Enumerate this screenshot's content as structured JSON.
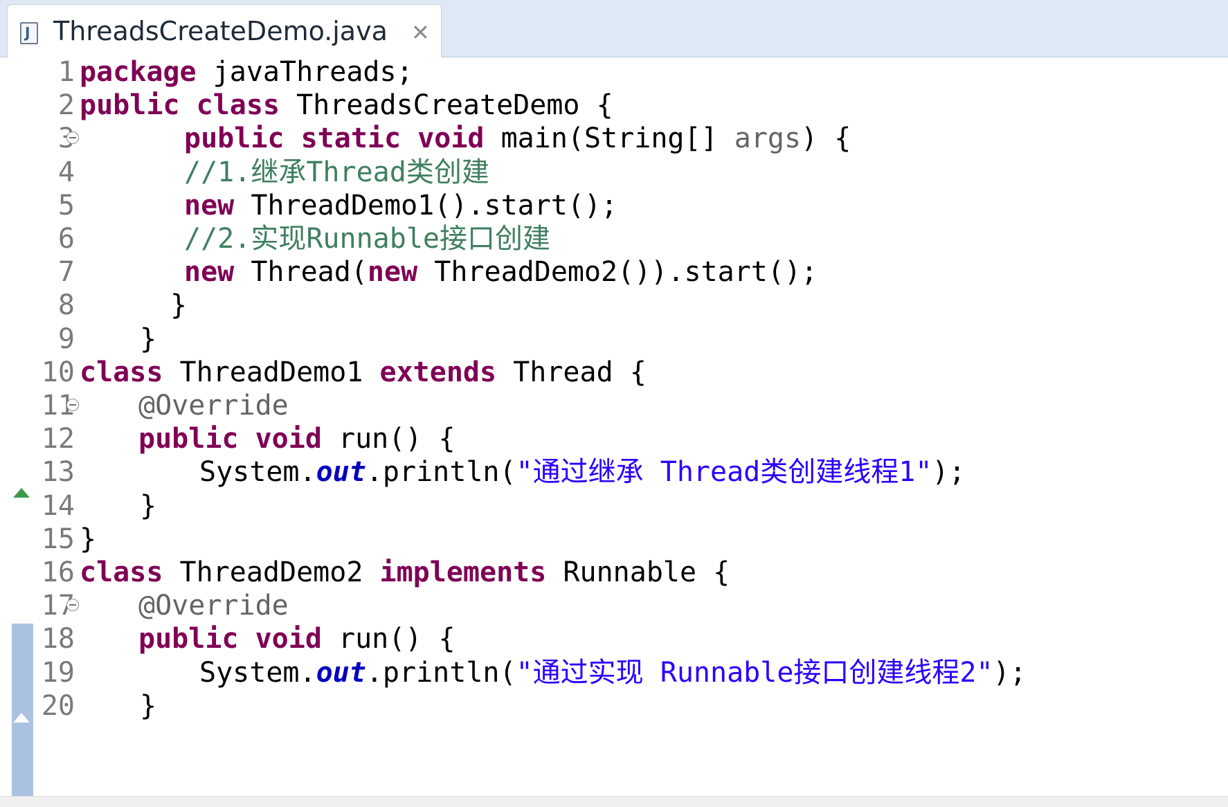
{
  "editor_tab": {
    "title": "ThreadsCreateDemo.java",
    "file_icon": "java-file-icon",
    "close_glyph": "✕"
  },
  "colors": {
    "keyword": "#7f0055",
    "comment": "#3f7f5f",
    "string": "#2a00ff",
    "annotation": "#646464",
    "static_field": "#0000c0",
    "line_number": "#7a7a7a",
    "tab_bar": "#dfe9f5",
    "range_indicator": "#aac2e0"
  },
  "code": {
    "lines": [
      {
        "n": "1",
        "foldable": false,
        "tokens": [
          {
            "t": "package",
            "k": "kw"
          },
          {
            "t": " javaThreads;",
            "k": "ty"
          }
        ]
      },
      {
        "n": "2",
        "foldable": false,
        "tokens": [
          {
            "t": "public",
            "k": "kw"
          },
          {
            "t": " ",
            "k": "ty"
          },
          {
            "t": "class",
            "k": "kw"
          },
          {
            "t": " ThreadsCreateDemo {",
            "k": "ty"
          }
        ]
      },
      {
        "n": "3",
        "foldable": true,
        "tokens": [
          {
            "t": "public",
            "k": "kw"
          },
          {
            "t": " ",
            "k": "ty"
          },
          {
            "t": "static",
            "k": "kw"
          },
          {
            "t": " ",
            "k": "ty"
          },
          {
            "t": "void",
            "k": "kw"
          },
          {
            "t": " main(String[] ",
            "k": "ty"
          },
          {
            "t": "args",
            "k": "an"
          },
          {
            "t": ") {",
            "k": "ty"
          }
        ]
      },
      {
        "n": "4",
        "foldable": false,
        "tokens": [
          {
            "t": "//1.继承Thread类创建",
            "k": "cm"
          }
        ]
      },
      {
        "n": "5",
        "foldable": false,
        "tokens": [
          {
            "t": "new",
            "k": "kw"
          },
          {
            "t": " ThreadDemo1().start();",
            "k": "ty"
          }
        ]
      },
      {
        "n": "6",
        "foldable": false,
        "tokens": [
          {
            "t": "//2.实现Runnable接口创建",
            "k": "cm"
          }
        ]
      },
      {
        "n": "7",
        "foldable": false,
        "tokens": [
          {
            "t": "new",
            "k": "kw"
          },
          {
            "t": " Thread(",
            "k": "ty"
          },
          {
            "t": "new",
            "k": "kw"
          },
          {
            "t": " ThreadDemo2()).start();",
            "k": "ty"
          }
        ]
      },
      {
        "n": "8",
        "foldable": false,
        "tokens": [
          {
            "t": "}",
            "k": "ty"
          }
        ]
      },
      {
        "n": "9",
        "foldable": false,
        "tokens": [
          {
            "t": "}",
            "k": "ty"
          }
        ]
      },
      {
        "n": "10",
        "foldable": false,
        "tokens": [
          {
            "t": "class",
            "k": "kw"
          },
          {
            "t": " ThreadDemo1 ",
            "k": "ty"
          },
          {
            "t": "extends",
            "k": "kw"
          },
          {
            "t": " Thread {",
            "k": "ty"
          }
        ]
      },
      {
        "n": "11",
        "foldable": true,
        "tokens": [
          {
            "t": "@Override",
            "k": "an"
          }
        ]
      },
      {
        "n": "12",
        "foldable": false,
        "tokens": [
          {
            "t": "public",
            "k": "kw"
          },
          {
            "t": " ",
            "k": "ty"
          },
          {
            "t": "void",
            "k": "kw"
          },
          {
            "t": " run() {",
            "k": "ty"
          }
        ]
      },
      {
        "n": "13",
        "foldable": false,
        "tokens": [
          {
            "t": "System.",
            "k": "ty"
          },
          {
            "t": "out",
            "k": "fi"
          },
          {
            "t": ".println(",
            "k": "ty"
          },
          {
            "t": "\"通过继承 Thread类创建线程1\"",
            "k": "st"
          },
          {
            "t": ");",
            "k": "ty"
          }
        ]
      },
      {
        "n": "14",
        "foldable": false,
        "tokens": [
          {
            "t": "}",
            "k": "ty"
          }
        ]
      },
      {
        "n": "15",
        "foldable": false,
        "tokens": [
          {
            "t": "}",
            "k": "ty"
          }
        ]
      },
      {
        "n": "16",
        "foldable": false,
        "tokens": [
          {
            "t": "class",
            "k": "kw"
          },
          {
            "t": " ThreadDemo2 ",
            "k": "ty"
          },
          {
            "t": "implements",
            "k": "kw"
          },
          {
            "t": " Runnable ",
            "k": "ty"
          },
          {
            "t": "{",
            "k": "ty"
          }
        ]
      },
      {
        "n": "17",
        "foldable": true,
        "tokens": [
          {
            "t": "@Override",
            "k": "an"
          }
        ]
      },
      {
        "n": "18",
        "foldable": false,
        "tokens": [
          {
            "t": "public",
            "k": "kw"
          },
          {
            "t": " ",
            "k": "ty"
          },
          {
            "t": "void",
            "k": "kw"
          },
          {
            "t": " run() {",
            "k": "ty"
          }
        ]
      },
      {
        "n": "19",
        "foldable": false,
        "tokens": [
          {
            "t": "System.",
            "k": "ty"
          },
          {
            "t": "out",
            "k": "fi"
          },
          {
            "t": ".println(",
            "k": "ty"
          },
          {
            "t": "\"通过实现 Runnable接口创建线程2\"",
            "k": "st"
          },
          {
            "t": ");",
            "k": "ty"
          }
        ]
      },
      {
        "n": "20",
        "foldable": false,
        "tokens": [
          {
            "t": "}",
            "k": "ty"
          }
        ]
      }
    ]
  },
  "gutter_markers": [
    {
      "line": "12",
      "type": "override-marker-icon"
    },
    {
      "line": "18",
      "type": "override-marker-icon"
    }
  ]
}
